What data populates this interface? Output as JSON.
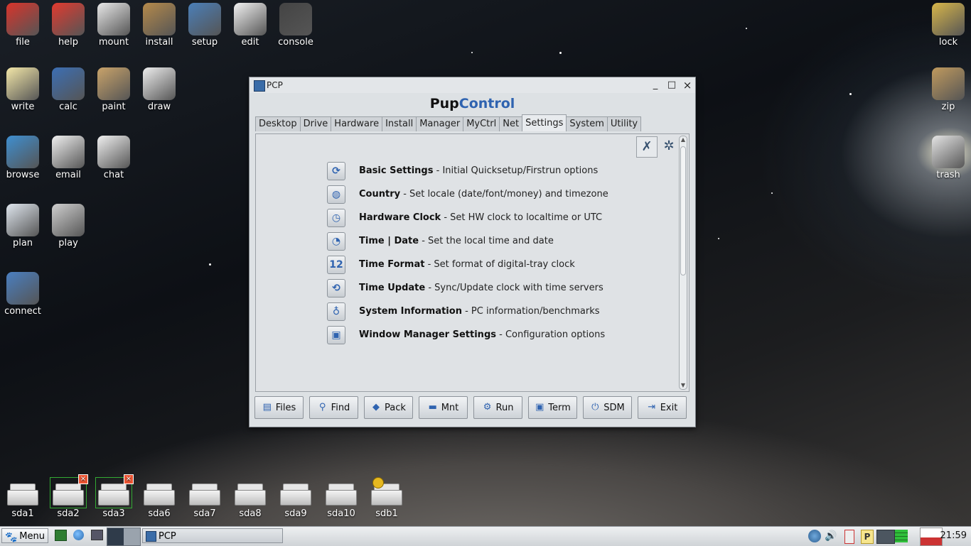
{
  "desktop_icons": [
    {
      "label": "file",
      "icon": "folder-house-icon",
      "color": "#d9342b"
    },
    {
      "label": "help",
      "icon": "lifebuoy-icon",
      "color": "#e23a2f"
    },
    {
      "label": "mount",
      "icon": "drive-icon",
      "color": "#e8e8e8"
    },
    {
      "label": "install",
      "icon": "package-box-icon",
      "color": "#b58a4b"
    },
    {
      "label": "setup",
      "icon": "tools-monitor-icon",
      "color": "#4b7fb8"
    },
    {
      "label": "edit",
      "icon": "notepad-pencil-icon",
      "color": "#f2f2f2"
    },
    {
      "label": "console",
      "icon": "terminal-icon",
      "color": "#444"
    },
    {
      "label": "write",
      "icon": "document-icon",
      "color": "#f3e7a8"
    },
    {
      "label": "calc",
      "icon": "spreadsheet-chart-icon",
      "color": "#3c6fb4"
    },
    {
      "label": "paint",
      "icon": "palette-brush-icon",
      "color": "#c9a36a"
    },
    {
      "label": "draw",
      "icon": "drawing-pencil-icon",
      "color": "#eeeeee"
    },
    {
      "label": "browse",
      "icon": "globe-icon",
      "color": "#3f8fd0"
    },
    {
      "label": "email",
      "icon": "envelope-icon",
      "color": "#f0f0f0"
    },
    {
      "label": "chat",
      "icon": "speech-bubble-icon",
      "color": "#f0f0f0"
    },
    {
      "label": "plan",
      "icon": "clock-icon",
      "color": "#dfe6ee"
    },
    {
      "label": "play",
      "icon": "film-reel-icon",
      "color": "#cfcfcf"
    },
    {
      "label": "connect",
      "icon": "network-computers-icon",
      "color": "#4a7fc0"
    },
    {
      "label": "lock",
      "icon": "padlock-icon",
      "color": "#d8b64a"
    },
    {
      "label": "zip",
      "icon": "archive-box-icon",
      "color": "#c09a5e"
    },
    {
      "label": "trash",
      "icon": "recycle-bin-icon",
      "color": "#e5e5e5"
    }
  ],
  "drives": [
    {
      "label": "sda1",
      "mounted": false
    },
    {
      "label": "sda2",
      "mounted": true
    },
    {
      "label": "sda3",
      "mounted": true
    },
    {
      "label": "sda6",
      "mounted": false
    },
    {
      "label": "sda7",
      "mounted": false
    },
    {
      "label": "sda8",
      "mounted": false
    },
    {
      "label": "sda9",
      "mounted": false
    },
    {
      "label": "sda10",
      "mounted": false
    },
    {
      "label": "sdb1",
      "mounted": false,
      "usb": true
    }
  ],
  "window": {
    "title": "PCP",
    "heading_a": "Pup",
    "heading_b": "Control",
    "minimize": "_",
    "maximize": "□",
    "close": "×",
    "tabs": [
      "Desktop",
      "Drive",
      "Hardware",
      "Install",
      "Manager",
      "MyCtrl",
      "Net",
      "Settings",
      "System",
      "Utility"
    ],
    "active_tab": "Settings",
    "items": [
      {
        "name": "Basic Settings",
        "desc": " - Initial Quicksetup/Firstrun options",
        "icon": "refresh-icon"
      },
      {
        "name": "Country",
        "desc": " - Set locale (date/font/money) and timezone",
        "icon": "globe-icon"
      },
      {
        "name": "Hardware Clock",
        "desc": " - Set HW clock to localtime or UTC",
        "icon": "hw-clock-icon"
      },
      {
        "name": "Time | Date",
        "desc": " - Set the local time and date",
        "icon": "time-date-icon"
      },
      {
        "name": "Time Format",
        "desc": " - Set format of digital-tray clock",
        "icon": "digital-12-icon"
      },
      {
        "name": "Time Update",
        "desc": " - Sync/Update clock with time servers",
        "icon": "sync-clock-icon"
      },
      {
        "name": "System Information",
        "desc": " - PC information/benchmarks",
        "icon": "lightbulb-icon"
      },
      {
        "name": "Window Manager Settings",
        "desc": " - Configuration options",
        "icon": "window-settings-icon"
      }
    ],
    "buttons": [
      {
        "label": "Files",
        "icon": "files-icon",
        "glyph": "▤"
      },
      {
        "label": "Find",
        "icon": "magnifier-icon",
        "glyph": "⚲"
      },
      {
        "label": "Pack",
        "icon": "package-icon",
        "glyph": "◆"
      },
      {
        "label": "Mnt",
        "icon": "mount-drive-icon",
        "glyph": "▬"
      },
      {
        "label": "Run",
        "icon": "gear-run-icon",
        "glyph": "⚙"
      },
      {
        "label": "Term",
        "icon": "terminal-icon",
        "glyph": "▣"
      },
      {
        "label": "SDM",
        "icon": "power-icon",
        "glyph": "⏻"
      },
      {
        "label": "Exit",
        "icon": "exit-door-icon",
        "glyph": "⇥"
      }
    ]
  },
  "taskbar": {
    "menu_label": "Menu",
    "task_label": "PCP",
    "clock": "21:59"
  }
}
